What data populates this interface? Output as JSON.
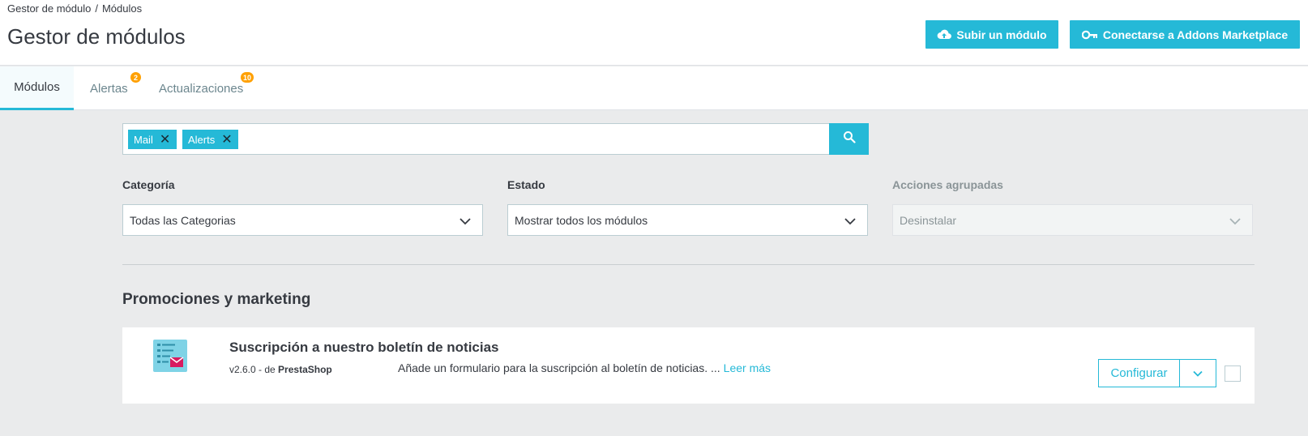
{
  "breadcrumb": {
    "parent": "Gestor de módulo",
    "separator": "/",
    "current": "Módulos"
  },
  "page_title": "Gestor de módulos",
  "toolbar": {
    "upload_label": "Subir un módulo",
    "upload_icon": "cloud-upload-icon",
    "addons_label": "Conectarse a Addons Marketplace",
    "addons_icon": "key-icon"
  },
  "tabs": [
    {
      "label": "Módulos",
      "active": true
    },
    {
      "label": "Alertas",
      "badge": "2"
    },
    {
      "label": "Actualizaciones",
      "badge": "10"
    }
  ],
  "search": {
    "chips": [
      "Mail",
      "Alerts"
    ],
    "chip_remove_glyph": "✕",
    "button_icon": "search-icon"
  },
  "filters": {
    "category": {
      "label": "Categoría",
      "value": "Todas las Categorias"
    },
    "status": {
      "label": "Estado",
      "value": "Mostrar todos los módulos"
    },
    "bulk": {
      "label": "Acciones agrupadas",
      "value": "Desinstalar",
      "disabled": true
    }
  },
  "section_title": "Promociones y marketing",
  "module": {
    "name": "Suscripción a nuestro boletín de noticias",
    "version": "v2.6.0 - de",
    "author": "PrestaShop",
    "description": "Añade un formulario para la suscripción al boletín de noticias. ...",
    "read_more": "Leer más",
    "configure_label": "Configurar",
    "icon": "newsletter-icon"
  },
  "colors": {
    "accent": "#25b9d7",
    "badge": "#ffa000",
    "background": "#eaebec"
  }
}
